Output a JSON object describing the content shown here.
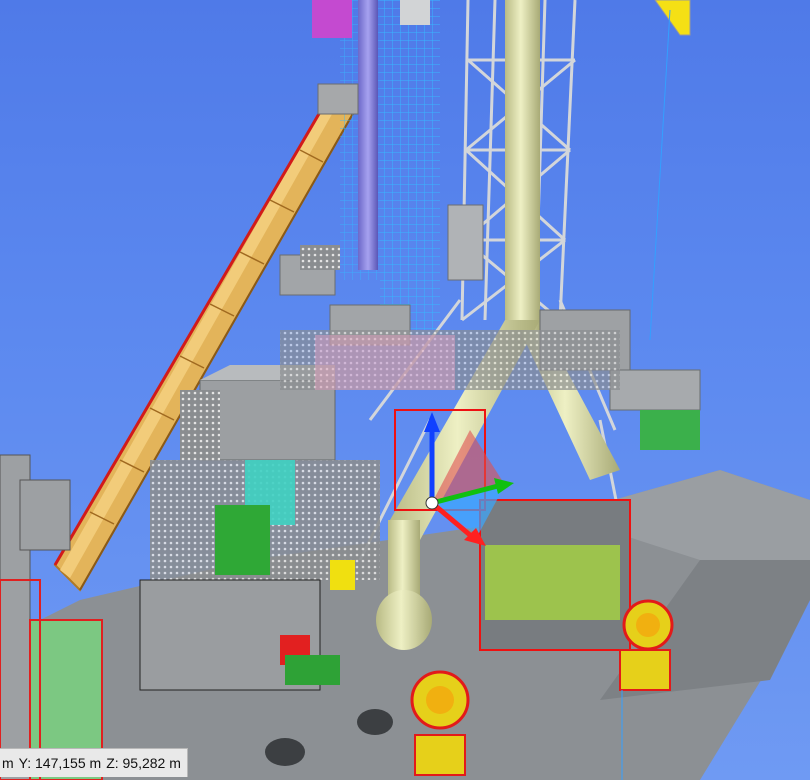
{
  "viewer": {
    "status": {
      "x_unit_fragment": "m",
      "y_readout": "Y: 147,155 m",
      "z_readout": "Z: 95,282 m"
    },
    "colors": {
      "sky": "#5b88ef",
      "ground": "#8c9094",
      "steel": "#9b9ea1",
      "truss": "#c9ccd0",
      "pipe": "#d6d8a8",
      "conveyor": "#e0b255",
      "railing": "#ee1111",
      "axis_x": "#ff2020",
      "axis_y": "#10c010",
      "axis_z": "#1040ff"
    },
    "icons": [
      "gizmo-x-arrow-icon",
      "gizmo-y-arrow-icon",
      "gizmo-z-arrow-icon"
    ]
  }
}
